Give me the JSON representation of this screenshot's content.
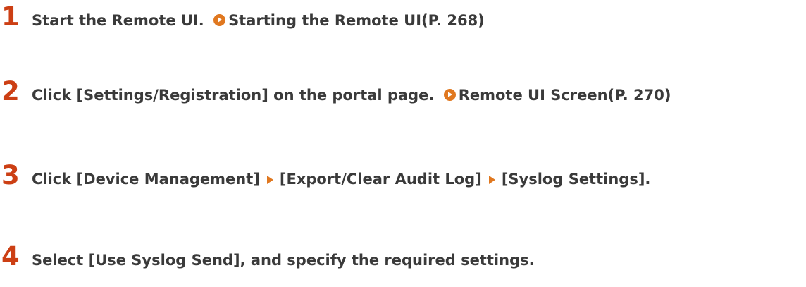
{
  "steps": [
    {
      "number": "1",
      "text": "Start the Remote UI.",
      "link": "Starting the Remote UI(P. 268)"
    },
    {
      "number": "2",
      "text": "Click [Settings/Registration] on the portal page.",
      "link": "Remote UI Screen(P. 270)"
    },
    {
      "number": "3",
      "parts": [
        "Click [Device Management]",
        "[Export/Clear Audit Log]",
        "[Syslog Settings]."
      ]
    },
    {
      "number": "4",
      "text": "Select [Use Syslog Send], and specify the required settings."
    }
  ],
  "colors": {
    "step_number": "#cc3f14",
    "text": "#3a3a3a",
    "link_icon": "#e07820",
    "arrow_icon": "#e07820"
  },
  "icons": {
    "link": "circle-play-icon",
    "separator": "triangle-right-icon"
  }
}
